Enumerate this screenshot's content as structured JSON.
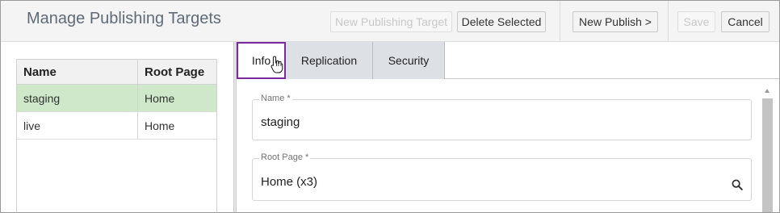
{
  "header": {
    "title": "Manage Publishing Targets",
    "new_target_label": "New Publishing Target",
    "delete_selected_label": "Delete Selected",
    "new_publish_label": "New Publish  >",
    "save_label": "Save",
    "cancel_label": "Cancel"
  },
  "targets_table": {
    "columns": [
      "Name",
      "Root Page"
    ],
    "rows": [
      {
        "name": "staging",
        "root_page": "Home",
        "selected": true
      },
      {
        "name": "live",
        "root_page": "Home",
        "selected": false
      }
    ]
  },
  "tabs": [
    {
      "label": "Info",
      "active": true
    },
    {
      "label": "Replication",
      "active": false
    },
    {
      "label": "Security",
      "active": false
    }
  ],
  "form": {
    "name_label": "Name *",
    "name_value": "staging",
    "root_page_label": "Root Page *",
    "root_page_value": "Home (x3)"
  },
  "colors": {
    "selected_row": "#cfe8c9",
    "active_tab_border": "#7a2a9c",
    "title": "#606b78"
  },
  "icons": {
    "root_page_lookup": "search-icon",
    "cursor": "hand-pointer-icon"
  }
}
